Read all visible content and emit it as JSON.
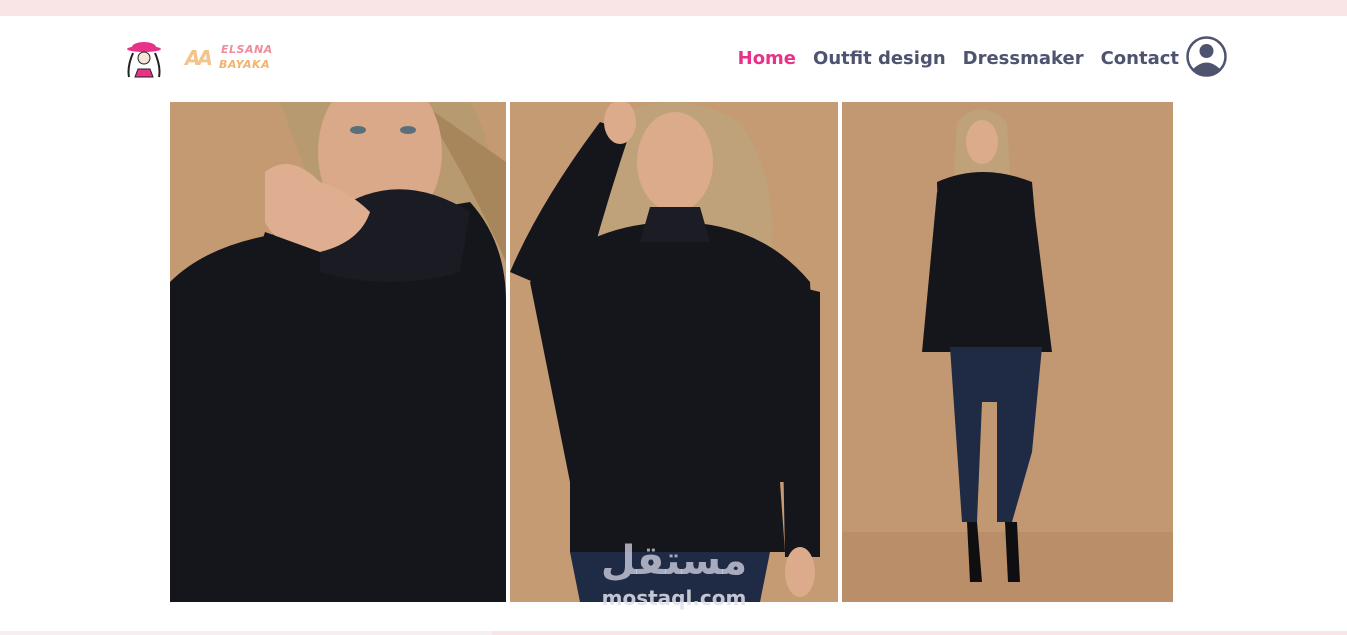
{
  "header": {
    "logo_mark": "woman-with-hat-logo",
    "logo_text_mono": "AA",
    "logo_text_line1": "ELSANA",
    "logo_text_line2": "BAYAKA"
  },
  "nav": {
    "items": [
      {
        "label": "Home",
        "active": true
      },
      {
        "label": "Outfit design",
        "active": false
      },
      {
        "label": "Dressmaker",
        "active": false
      },
      {
        "label": "Contact",
        "active": false
      }
    ],
    "account_icon": "user-circle-icon"
  },
  "gallery": {
    "photos": [
      {
        "subject": "model in black turtleneck sweater, close-up"
      },
      {
        "subject": "model in black turtleneck sweater, waist-up"
      },
      {
        "subject": "model in black turtleneck sweater and jeans, full body"
      }
    ]
  },
  "watermark": {
    "arabic": "مستقل",
    "latin": "mostaql.com"
  },
  "colors": {
    "accent": "#e8328a",
    "nav_text": "#4e5470",
    "top_strip": "#f9e4e6",
    "photo_bg": "#c49a72",
    "sweater": "#15161c"
  }
}
